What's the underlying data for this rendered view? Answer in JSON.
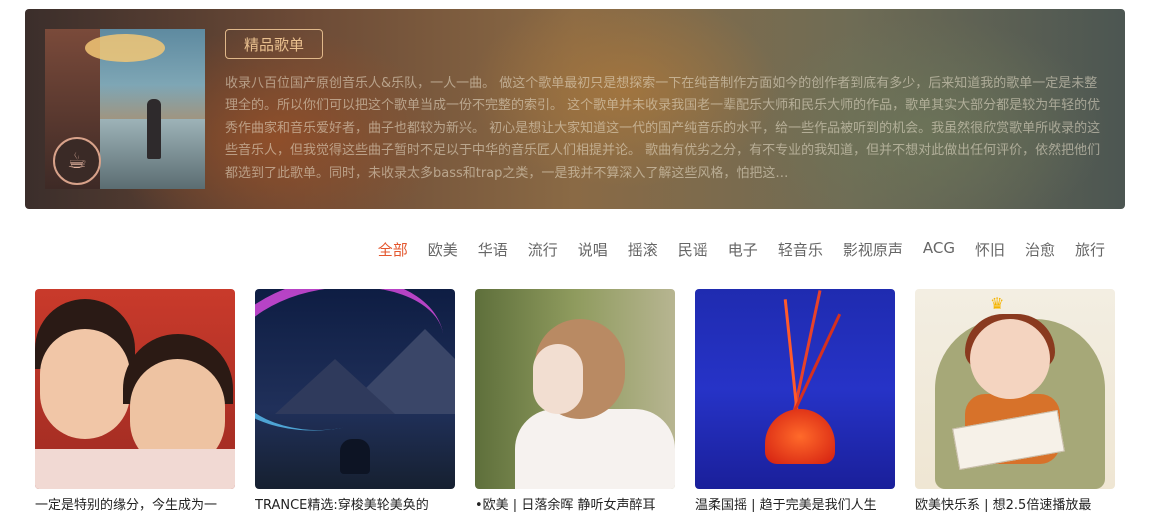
{
  "banner": {
    "tag": "精品歌单",
    "description": "收录八百位国产原创音乐人&乐队，一人一曲。 做这个歌单最初只是想探索一下在纯音制作方面如今的创作者到底有多少，后来知道我的歌单一定是未整理全的。所以你们可以把这个歌单当成一份不完整的索引。 这个歌单并未收录我国老一辈配乐大师和民乐大师的作品，歌单其实大部分都是较为年轻的优秀作曲家和音乐爱好者，曲子也都较为新兴。 初心是想让大家知道这一代的国产纯音乐的水平，给一些作品被听到的机会。我虽然很欣赏歌单所收录的这些音乐人，但我觉得这些曲子暂时不足以于中华的音乐匠人们相提并论。 歌曲有优劣之分，有不专业的我知道，但并不想对此做出任何评价，依然把他们都选到了此歌单。同时，未收录太多bass和trap之类，一是我并不算深入了解这些风格，怕把这…"
  },
  "categories": [
    "全部",
    "欧美",
    "华语",
    "流行",
    "说唱",
    "摇滚",
    "民谣",
    "电子",
    "轻音乐",
    "影视原声",
    "ACG",
    "怀旧",
    "治愈",
    "旅行"
  ],
  "active_category": "全部",
  "playlists": [
    {
      "caption": "一定是特别的缘分，今生成为一"
    },
    {
      "caption": "TRANCE精选:穿梭美轮美奂的"
    },
    {
      "caption": "•欧美 | 日落余晖 静听女声醉耳"
    },
    {
      "caption": "温柔国摇 | 趋于完美是我们人生"
    },
    {
      "caption": "欧美快乐系 | 想2.5倍速播放最"
    }
  ],
  "colors": {
    "accent": "#e4572e",
    "tag": "#e9c08f"
  }
}
